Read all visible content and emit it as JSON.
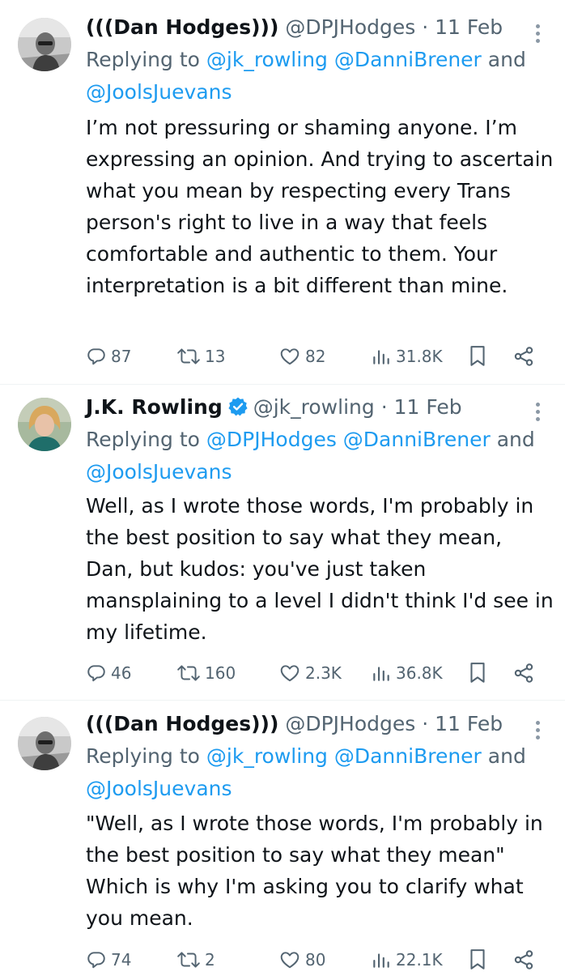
{
  "colors": {
    "accent": "#1d9bf0",
    "text": "#0f1419",
    "muted": "#536471",
    "verified": "#1d9bf0"
  },
  "tweets": [
    {
      "display_name": "(((Dan Hodges)))",
      "handle": "@DPJHodges",
      "separator": "·",
      "date": "11 Feb",
      "verified": false,
      "avatar_icon": "profile-photo-grayscale",
      "replying_to_prefix": "Replying to",
      "mention_1": "@jk_rowling",
      "mention_2": "@DanniBrener",
      "replying_to_and": "and",
      "mention_3": "@JoolsJuevans",
      "text": "I’m not pressuring or shaming anyone. I’m expressing an opinion. And trying to ascertain what you mean by respecting every Trans person's right to live in a way that feels comfortable and authentic to them. Your interpretation is a bit different than mine.",
      "replies": "87",
      "reposts": "13",
      "likes": "82",
      "views": "31.8K"
    },
    {
      "display_name": "J.K. Rowling",
      "handle": "@jk_rowling",
      "separator": "·",
      "date": "11 Feb",
      "verified": true,
      "avatar_icon": "profile-photo-color",
      "replying_to_prefix": "Replying to",
      "mention_1": "@DPJHodges",
      "mention_2": "@DanniBrener",
      "replying_to_and": "and",
      "mention_3": "@JoolsJuevans",
      "text": "Well, as I wrote those words, I'm probably in the best position to say what they mean, Dan, but kudos: you've just taken mansplaining to a level I didn't think I'd see in my lifetime.",
      "replies": "46",
      "reposts": "160",
      "likes": "2.3K",
      "views": "36.8K"
    },
    {
      "display_name": "(((Dan Hodges)))",
      "handle": "@DPJHodges",
      "separator": "·",
      "date": "11 Feb",
      "verified": false,
      "avatar_icon": "profile-photo-grayscale",
      "replying_to_prefix": "Replying to",
      "mention_1": "@jk_rowling",
      "mention_2": "@DanniBrener",
      "replying_to_and": "and",
      "mention_3": "@JoolsJuevans",
      "text": "\"Well, as I wrote those words, I'm probably in the best position to say what they mean\" Which is why I'm asking you to clarify what you mean.",
      "replies": "74",
      "reposts": "2",
      "likes": "80",
      "views": "22.1K"
    }
  ]
}
